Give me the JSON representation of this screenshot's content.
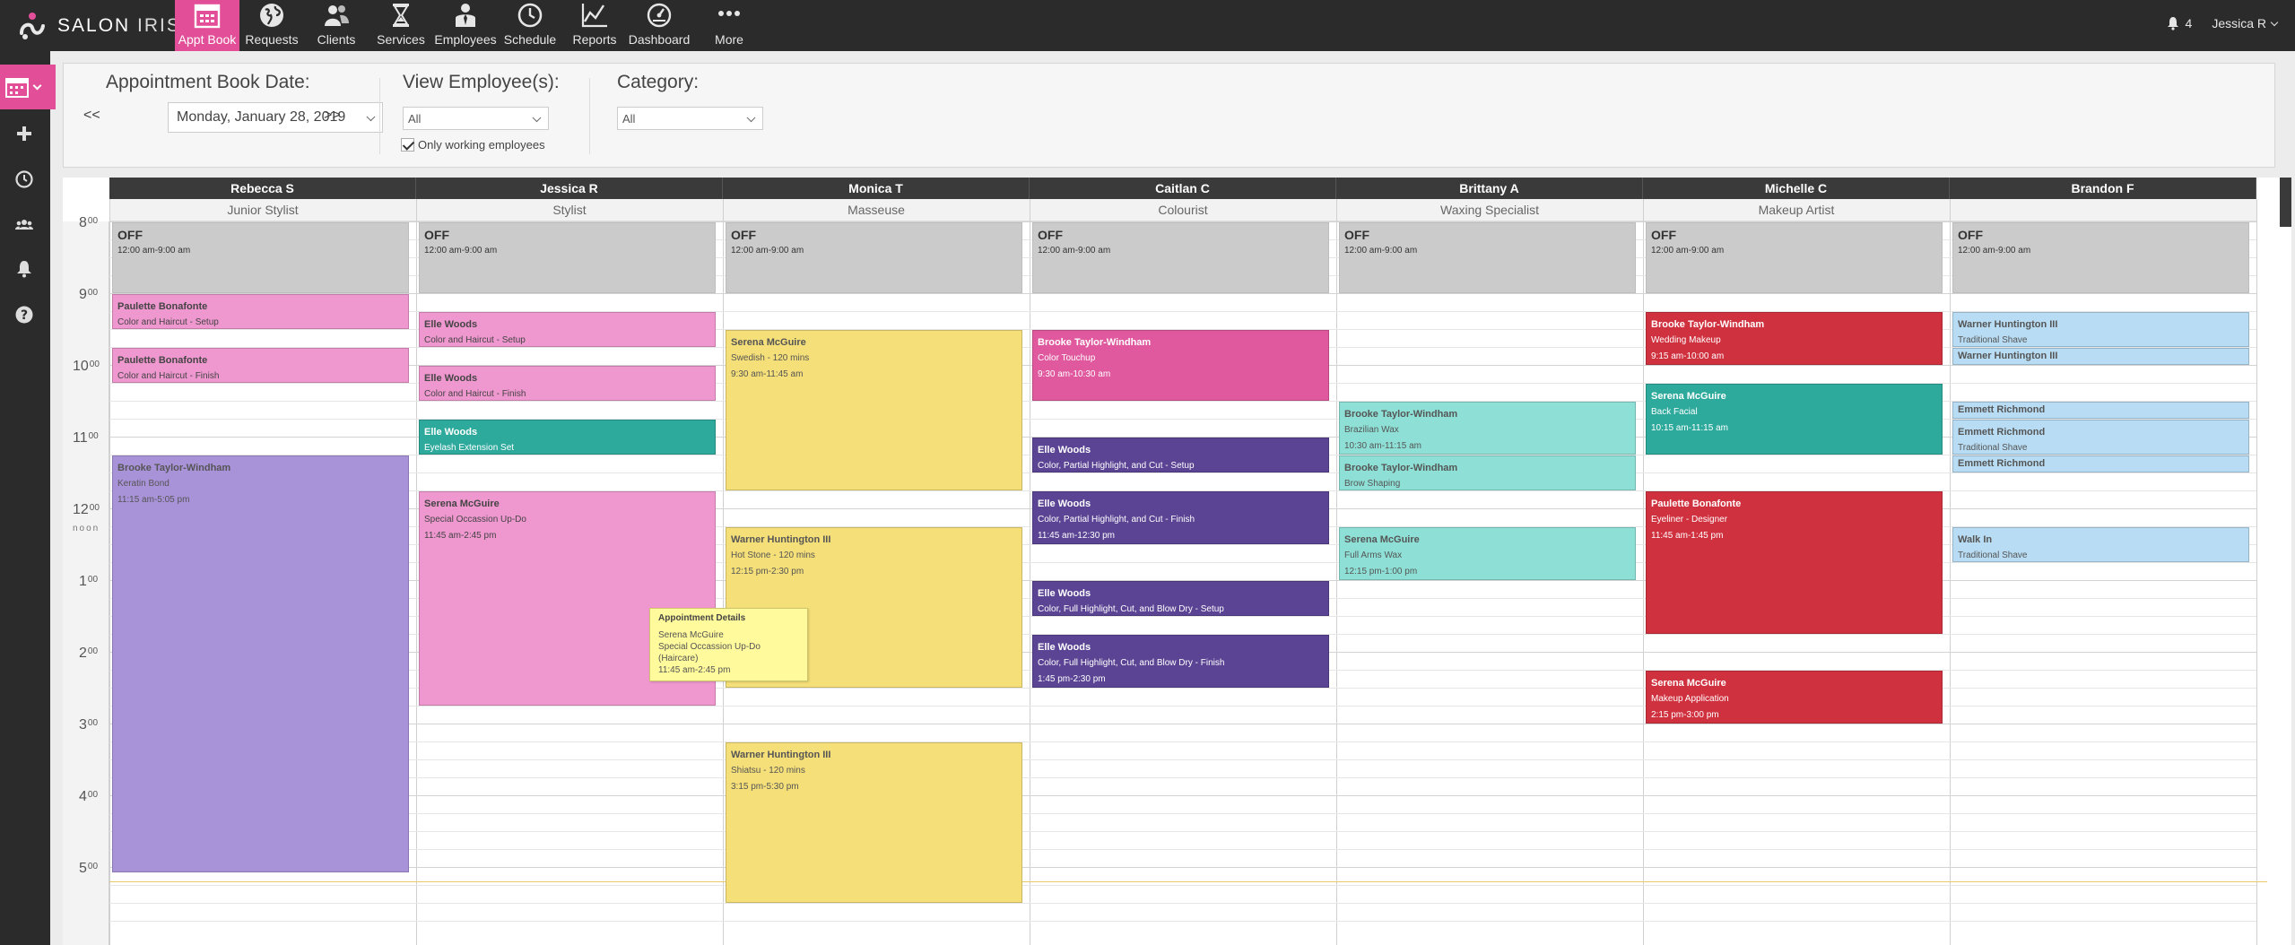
{
  "brand": {
    "name_a": "SALON ",
    "name_b": "IRIS"
  },
  "nav": [
    {
      "label": "Appt Book",
      "icon": "calendar-icon",
      "active": true
    },
    {
      "label": "Requests",
      "icon": "globe-icon"
    },
    {
      "label": "Clients",
      "icon": "people-icon"
    },
    {
      "label": "Services",
      "icon": "hourglass-icon"
    },
    {
      "label": "Employees",
      "icon": "employee-icon"
    },
    {
      "label": "Schedule",
      "icon": "clock-icon"
    },
    {
      "label": "Reports",
      "icon": "chart-icon"
    },
    {
      "label": "Dashboard",
      "icon": "gauge-icon"
    },
    {
      "label": "More",
      "icon": "dots-icon"
    }
  ],
  "topright": {
    "notifications": "4",
    "user": "Jessica R"
  },
  "filters": {
    "date_label": "Appointment Book Date:",
    "prev": "<<",
    "next": ">>",
    "date_value": "Monday, January 28, 2019",
    "employee_label": "View Employee(s):",
    "employee_value": "All",
    "only_working": "Only working employees",
    "category_label": "Category:",
    "category_value": "All"
  },
  "hours": [
    "8",
    "9",
    "10",
    "11",
    "12",
    "1",
    "2",
    "3",
    "4",
    "5"
  ],
  "hour_suffix": "00",
  "noon_label": "noon",
  "employees": [
    {
      "name": "Rebecca S",
      "role": "Junior Stylist"
    },
    {
      "name": "Jessica R",
      "role": "Stylist"
    },
    {
      "name": "Monica T",
      "role": "Masseuse"
    },
    {
      "name": "Caitlan C",
      "role": "Colourist"
    },
    {
      "name": "Brittany A",
      "role": "Waxing Specialist"
    },
    {
      "name": "Michelle C",
      "role": "Makeup Artist"
    },
    {
      "name": "Brandon F",
      "role": ""
    }
  ],
  "appointments": [
    {
      "col": 0,
      "start": 8.0,
      "end": 9.0,
      "style": "off",
      "title": "OFF",
      "lines": [
        "12:00 am-9:00 am"
      ]
    },
    {
      "col": 1,
      "start": 8.0,
      "end": 9.0,
      "style": "off",
      "title": "OFF",
      "lines": [
        "12:00 am-9:00 am"
      ]
    },
    {
      "col": 2,
      "start": 8.0,
      "end": 9.0,
      "style": "off",
      "title": "OFF",
      "lines": [
        "12:00 am-9:00 am"
      ]
    },
    {
      "col": 3,
      "start": 8.0,
      "end": 9.0,
      "style": "off",
      "title": "OFF",
      "lines": [
        "12:00 am-9:00 am"
      ]
    },
    {
      "col": 4,
      "start": 8.0,
      "end": 9.0,
      "style": "off",
      "title": "OFF",
      "lines": [
        "12:00 am-9:00 am"
      ]
    },
    {
      "col": 5,
      "start": 8.0,
      "end": 9.0,
      "style": "off",
      "title": "OFF",
      "lines": [
        "12:00 am-9:00 am"
      ]
    },
    {
      "col": 6,
      "start": 8.0,
      "end": 9.0,
      "style": "off",
      "title": "OFF",
      "lines": [
        "12:00 am-9:00 am"
      ]
    },
    {
      "col": 0,
      "start": 9.0,
      "end": 9.5,
      "style": "pink",
      "title": "Paulette Bonafonte",
      "lines": [
        "Color and Haircut - Setup"
      ]
    },
    {
      "col": 0,
      "start": 9.75,
      "end": 10.25,
      "style": "pink",
      "title": "Paulette Bonafonte",
      "lines": [
        "Color and Haircut - Finish"
      ]
    },
    {
      "col": 0,
      "start": 11.25,
      "end": 17.08,
      "style": "purple",
      "title": "Brooke Taylor-Windham",
      "lines": [
        "Keratin Bond",
        "11:15 am-5:05 pm"
      ]
    },
    {
      "col": 1,
      "start": 9.25,
      "end": 9.75,
      "style": "pink",
      "title": "Elle Woods",
      "lines": [
        "Color and Haircut - Setup"
      ]
    },
    {
      "col": 1,
      "start": 10.0,
      "end": 10.5,
      "style": "pink",
      "title": "Elle Woods",
      "lines": [
        "Color and Haircut - Finish"
      ]
    },
    {
      "col": 1,
      "start": 10.75,
      "end": 11.25,
      "style": "teal",
      "title": "Elle Woods",
      "lines": [
        "Eyelash Extension Set"
      ]
    },
    {
      "col": 1,
      "start": 11.75,
      "end": 14.75,
      "style": "pink",
      "title": "Serena McGuire",
      "lines": [
        "Special Occassion Up-Do",
        "11:45 am-2:45 pm"
      ]
    },
    {
      "col": 2,
      "start": 9.5,
      "end": 11.75,
      "style": "yellow",
      "title": "Serena McGuire",
      "lines": [
        "Swedish - 120 mins",
        "9:30 am-11:45 am"
      ]
    },
    {
      "col": 2,
      "start": 12.25,
      "end": 14.5,
      "style": "yellow",
      "title": "Warner Huntington III",
      "lines": [
        "Hot Stone - 120 mins",
        "12:15 pm-2:30 pm"
      ]
    },
    {
      "col": 2,
      "start": 15.25,
      "end": 17.5,
      "style": "yellow",
      "title": "Warner Huntington III",
      "lines": [
        "Shiatsu - 120 mins",
        "3:15 pm-5:30 pm"
      ]
    },
    {
      "col": 3,
      "start": 9.5,
      "end": 10.5,
      "style": "magenta",
      "title": "Brooke Taylor-Windham",
      "lines": [
        "Color Touchup",
        "9:30 am-10:30 am"
      ]
    },
    {
      "col": 3,
      "start": 11.0,
      "end": 11.5,
      "style": "violet",
      "title": "Elle Woods",
      "lines": [
        "Color, Partial Highlight, and Cut - Setup"
      ]
    },
    {
      "col": 3,
      "start": 11.75,
      "end": 12.5,
      "style": "violet",
      "title": "Elle Woods",
      "lines": [
        "Color, Partial Highlight, and Cut - Finish",
        "11:45 am-12:30 pm"
      ]
    },
    {
      "col": 3,
      "start": 13.0,
      "end": 13.5,
      "style": "violet",
      "title": "Elle Woods",
      "lines": [
        "Color, Full Highlight, Cut, and Blow Dry - Setup"
      ]
    },
    {
      "col": 3,
      "start": 13.75,
      "end": 14.5,
      "style": "violet",
      "title": "Elle Woods",
      "lines": [
        "Color, Full Highlight, Cut, and Blow Dry - Finish",
        "1:45 pm-2:30 pm"
      ]
    },
    {
      "col": 4,
      "start": 10.5,
      "end": 11.25,
      "style": "lightteal",
      "title": "Brooke Taylor-Windham",
      "lines": [
        "Brazilian Wax",
        "10:30 am-11:15 am"
      ]
    },
    {
      "col": 4,
      "start": 11.25,
      "end": 11.75,
      "style": "lightteal",
      "title": "Brooke Taylor-Windham",
      "lines": [
        "Brow Shaping"
      ]
    },
    {
      "col": 4,
      "start": 12.25,
      "end": 13.0,
      "style": "lightteal",
      "title": "Serena McGuire",
      "lines": [
        "Full Arms Wax",
        "12:15 pm-1:00 pm"
      ]
    },
    {
      "col": 5,
      "start": 9.25,
      "end": 10.0,
      "style": "red",
      "title": "Brooke Taylor-Windham",
      "lines": [
        "Wedding Makeup",
        "9:15 am-10:00 am"
      ]
    },
    {
      "col": 5,
      "start": 10.25,
      "end": 11.25,
      "style": "teal",
      "title": "Serena McGuire",
      "lines": [
        "Back Facial",
        "10:15 am-11:15 am"
      ]
    },
    {
      "col": 5,
      "start": 11.75,
      "end": 13.75,
      "style": "red",
      "title": "Paulette Bonafonte",
      "lines": [
        "Eyeliner - Designer",
        "11:45 am-1:45 pm"
      ]
    },
    {
      "col": 5,
      "start": 14.25,
      "end": 15.0,
      "style": "red",
      "title": "Serena McGuire",
      "lines": [
        "Makeup Application",
        "2:15 pm-3:00 pm"
      ]
    },
    {
      "col": 6,
      "start": 9.25,
      "end": 9.75,
      "style": "lightblue",
      "title": "Warner Huntington III",
      "lines": [
        "Traditional Shave"
      ]
    },
    {
      "col": 6,
      "start": 9.75,
      "end": 10.0,
      "style": "lightblue",
      "title": "Warner Huntington III",
      "lines": []
    },
    {
      "col": 6,
      "start": 10.5,
      "end": 10.75,
      "style": "lightblue",
      "title": "Emmett Richmond",
      "lines": []
    },
    {
      "col": 6,
      "start": 10.75,
      "end": 11.25,
      "style": "lightblue",
      "title": "Emmett Richmond",
      "lines": [
        "Traditional Shave"
      ]
    },
    {
      "col": 6,
      "start": 11.25,
      "end": 11.5,
      "style": "lightblue",
      "title": "Emmett Richmond",
      "lines": []
    },
    {
      "col": 6,
      "start": 12.25,
      "end": 12.75,
      "style": "lightblue",
      "title": "Walk In",
      "lines": [
        "Traditional Shave"
      ]
    }
  ],
  "tooltip": {
    "title": "Appointment Details",
    "line1": "Serena McGuire",
    "line2": "Special Occassion Up-Do (Haircare)",
    "line3": "11:45 am-2:45 pm"
  },
  "colors": {
    "accent": "#e24f98",
    "bar": "#2b2b2b"
  }
}
